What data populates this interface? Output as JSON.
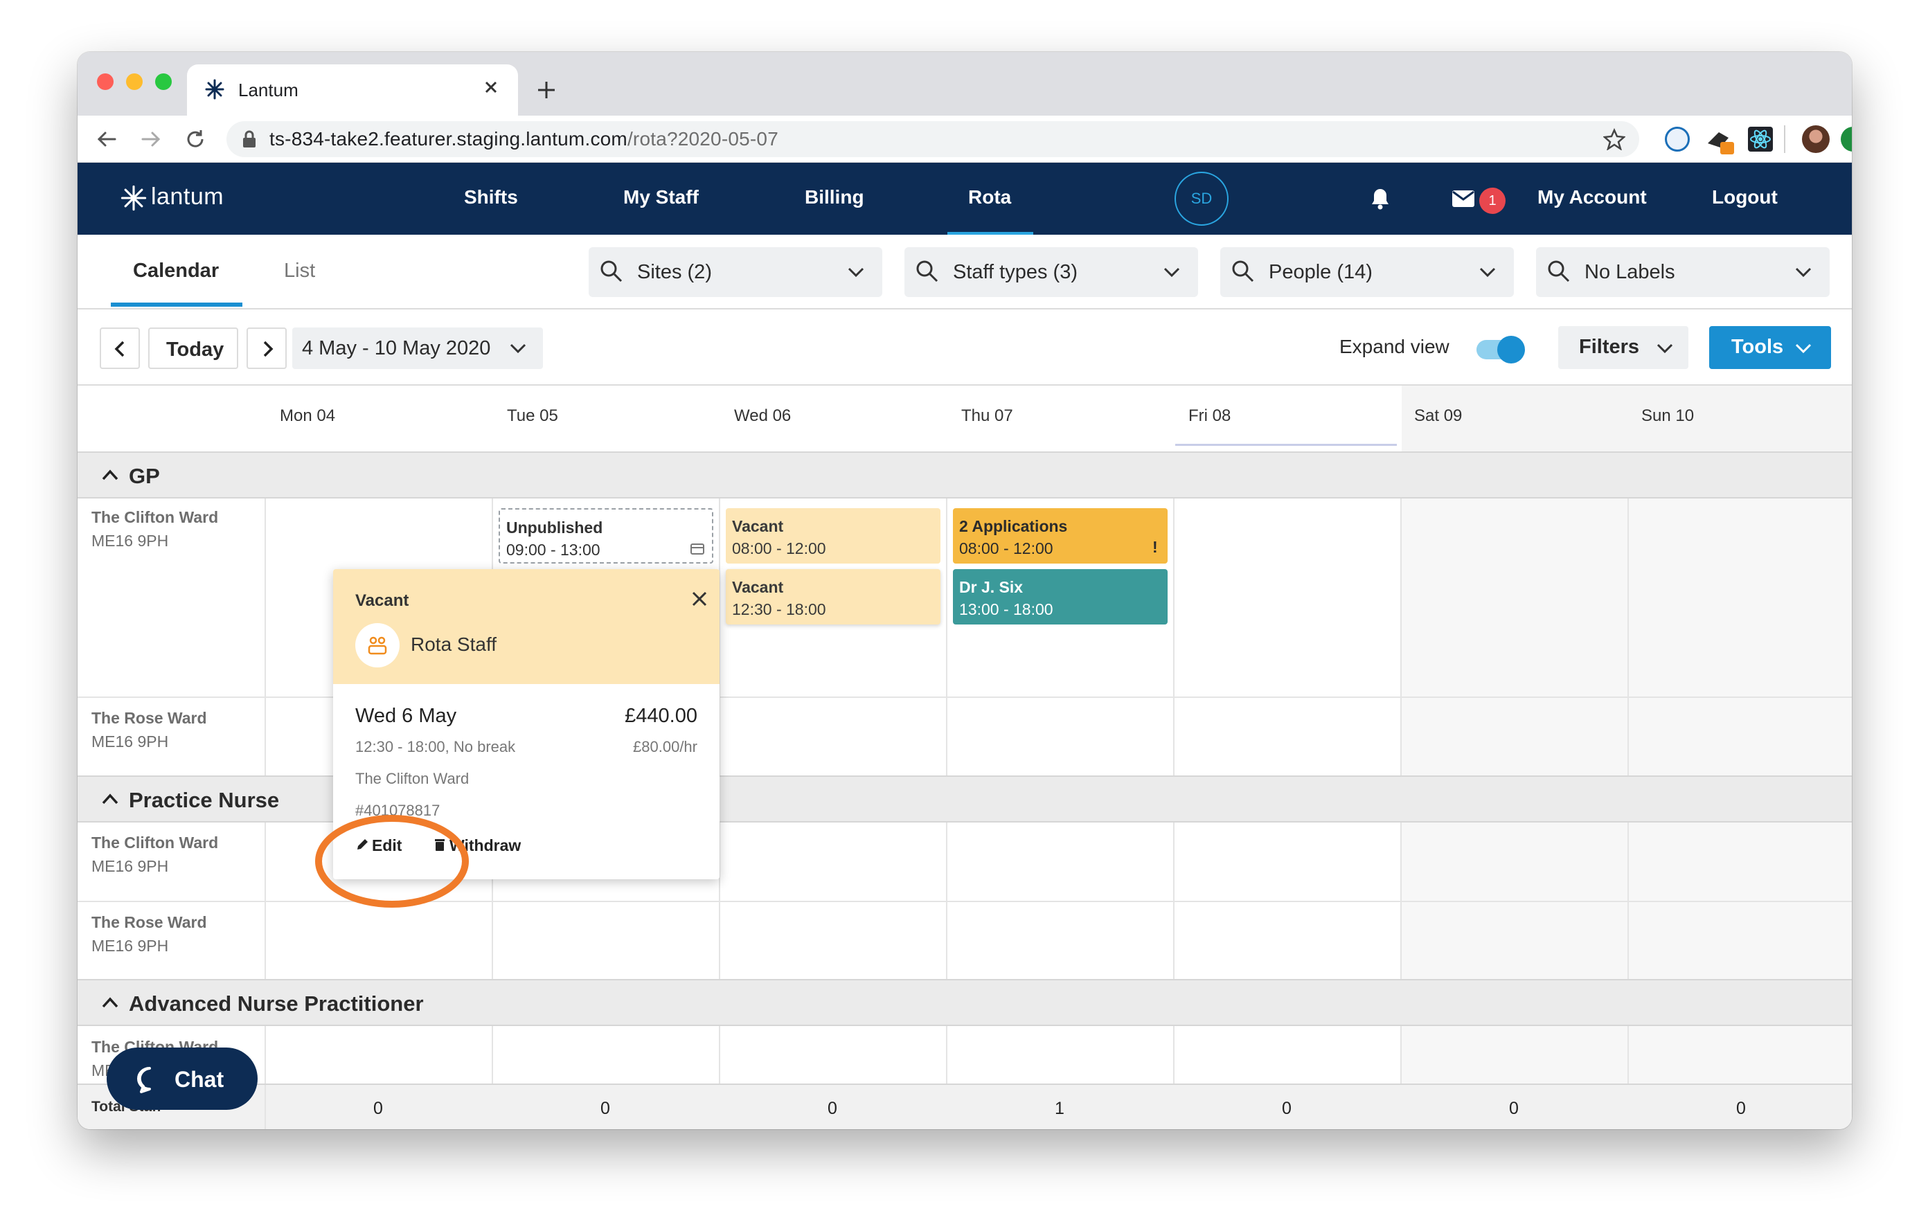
{
  "browser": {
    "tab_title": "Lantum",
    "url_host": "ts-834-take2.featurer.staging.lantum.com",
    "url_path": "/rota?2020-05-07"
  },
  "nav": {
    "brand": "lantum",
    "links": [
      "Shifts",
      "My Staff",
      "Billing",
      "Rota"
    ],
    "active_link": "Rota",
    "avatar_initials": "SD",
    "mail_badge": "1",
    "my_account": "My Account",
    "logout": "Logout"
  },
  "subnav": {
    "tabs": [
      "Calendar",
      "List"
    ],
    "active_tab": "Calendar",
    "filters": [
      "Sites (2)",
      "Staff types (3)",
      "People (14)",
      "No Labels"
    ]
  },
  "toolbar": {
    "today": "Today",
    "date_range": "4 May - 10 May 2020",
    "expand_view": "Expand view",
    "expand_view_on": true,
    "filters": "Filters",
    "tools": "Tools"
  },
  "calendar": {
    "days": [
      "Mon 04",
      "Tue 05",
      "Wed 06",
      "Thu 07",
      "Fri 08",
      "Sat 09",
      "Sun 10"
    ],
    "highlighted_day": "Fri 08",
    "sections": [
      {
        "title": "GP",
        "rows": [
          {
            "ward": "The Clifton Ward",
            "postcode": "ME16 9PH"
          },
          {
            "ward": "The Rose Ward",
            "postcode": "ME16 9PH"
          }
        ]
      },
      {
        "title": "Practice Nurse",
        "rows": [
          {
            "ward": "The Clifton Ward",
            "postcode": "ME16 9PH"
          },
          {
            "ward": "The Rose Ward",
            "postcode": "ME16 9PH"
          }
        ]
      },
      {
        "title": "Advanced Nurse Practitioner",
        "rows": [
          {
            "ward": "The Clifton Ward",
            "postcode": "ME16 9PH"
          }
        ]
      }
    ],
    "shifts": [
      {
        "title": "Unpublished",
        "time": "09:00 - 13:00",
        "day": "Tue 05"
      },
      {
        "title": "Vacant",
        "time": "08:00 - 12:00",
        "day": "Wed 06"
      },
      {
        "title": "Vacant",
        "time": "12:30 - 18:00",
        "day": "Wed 06"
      },
      {
        "title": "2 Applications",
        "time": "08:00 - 12:00",
        "day": "Thu 07",
        "flag": "!"
      },
      {
        "title": "Dr J. Six",
        "time": "13:00 - 18:00",
        "day": "Thu 07"
      }
    ],
    "total_label": "Total Staff",
    "totals": [
      "0",
      "0",
      "0",
      "1",
      "0",
      "0",
      "0"
    ]
  },
  "popover": {
    "status": "Vacant",
    "staff_type": "Rota Staff",
    "date": "Wed 6 May",
    "price": "£440.00",
    "time": "12:30 - 18:00, No break",
    "rate": "£80.00/hr",
    "ward": "The Clifton Ward",
    "shift_id": "#401078817",
    "edit": "Edit",
    "withdraw": "Withdraw"
  },
  "chat": {
    "label": "Chat"
  },
  "colors": {
    "nav_bg": "#0d2c54",
    "vacant": "#fde6b6",
    "applications": "#f5b941",
    "filled": "#3b9a9a",
    "primary_button": "#1a8fd1",
    "highlight_circle": "#f07b2a",
    "badge": "#e8474e"
  }
}
